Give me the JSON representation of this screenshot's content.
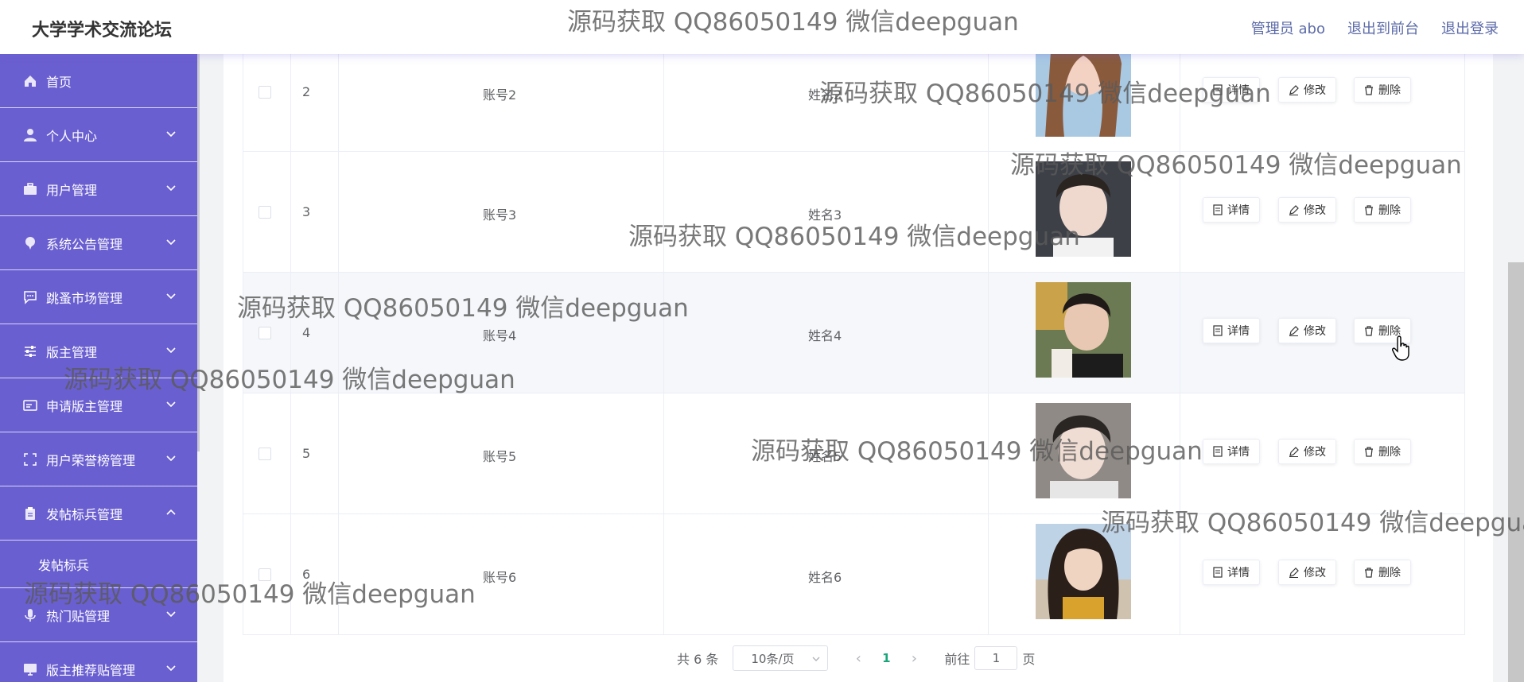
{
  "header": {
    "title": "大学学术交流论坛",
    "admin_label": "管理员 abo",
    "to_front_label": "退出到前台",
    "logout_label": "退出登录"
  },
  "sidebar": {
    "items": [
      {
        "label": "首页",
        "icon": "home-icon",
        "expandable": false
      },
      {
        "label": "个人中心",
        "icon": "user-icon",
        "expandable": true
      },
      {
        "label": "用户管理",
        "icon": "briefcase-icon",
        "expandable": true
      },
      {
        "label": "系统公告管理",
        "icon": "pin-icon",
        "expandable": true
      },
      {
        "label": "跳蚤市场管理",
        "icon": "message-icon",
        "expandable": true
      },
      {
        "label": "版主管理",
        "icon": "sliders-icon",
        "expandable": true
      },
      {
        "label": "申请版主管理",
        "icon": "card-icon",
        "expandable": true
      },
      {
        "label": "用户荣誉榜管理",
        "icon": "fullscreen-icon",
        "expandable": true
      },
      {
        "label": "发帖标兵管理",
        "icon": "clipboard-icon",
        "expandable": true,
        "expanded": true
      },
      {
        "label": "热门贴管理",
        "icon": "microphone-icon",
        "expandable": true
      },
      {
        "label": "版主推荐贴管理",
        "icon": "monitor-icon",
        "expandable": true
      }
    ],
    "sub_items": [
      "发帖标兵"
    ]
  },
  "table": {
    "rows": [
      {
        "index": "2",
        "account": "账号2",
        "name": "姓名2",
        "hover": false
      },
      {
        "index": "3",
        "account": "账号3",
        "name": "姓名3",
        "hover": false
      },
      {
        "index": "4",
        "account": "账号4",
        "name": "姓名4",
        "hover": true
      },
      {
        "index": "5",
        "account": "账号5",
        "name": "姓名5",
        "hover": false
      },
      {
        "index": "6",
        "account": "账号6",
        "name": "姓名6",
        "hover": false
      }
    ],
    "actions": {
      "detail": "详情",
      "edit": "修改",
      "delete": "删除"
    }
  },
  "pagination": {
    "total": "共 6 条",
    "page_size": "10条/页",
    "current_page": "1",
    "goto_prefix": "前往",
    "goto_value": "1",
    "goto_suffix": "页"
  },
  "watermark": "源码获取 QQ86050149 微信deepguan",
  "colors": {
    "sidebar_bg": "#6a5fd0",
    "header_link": "#5b6aa8",
    "active_page": "#1aa67a"
  }
}
